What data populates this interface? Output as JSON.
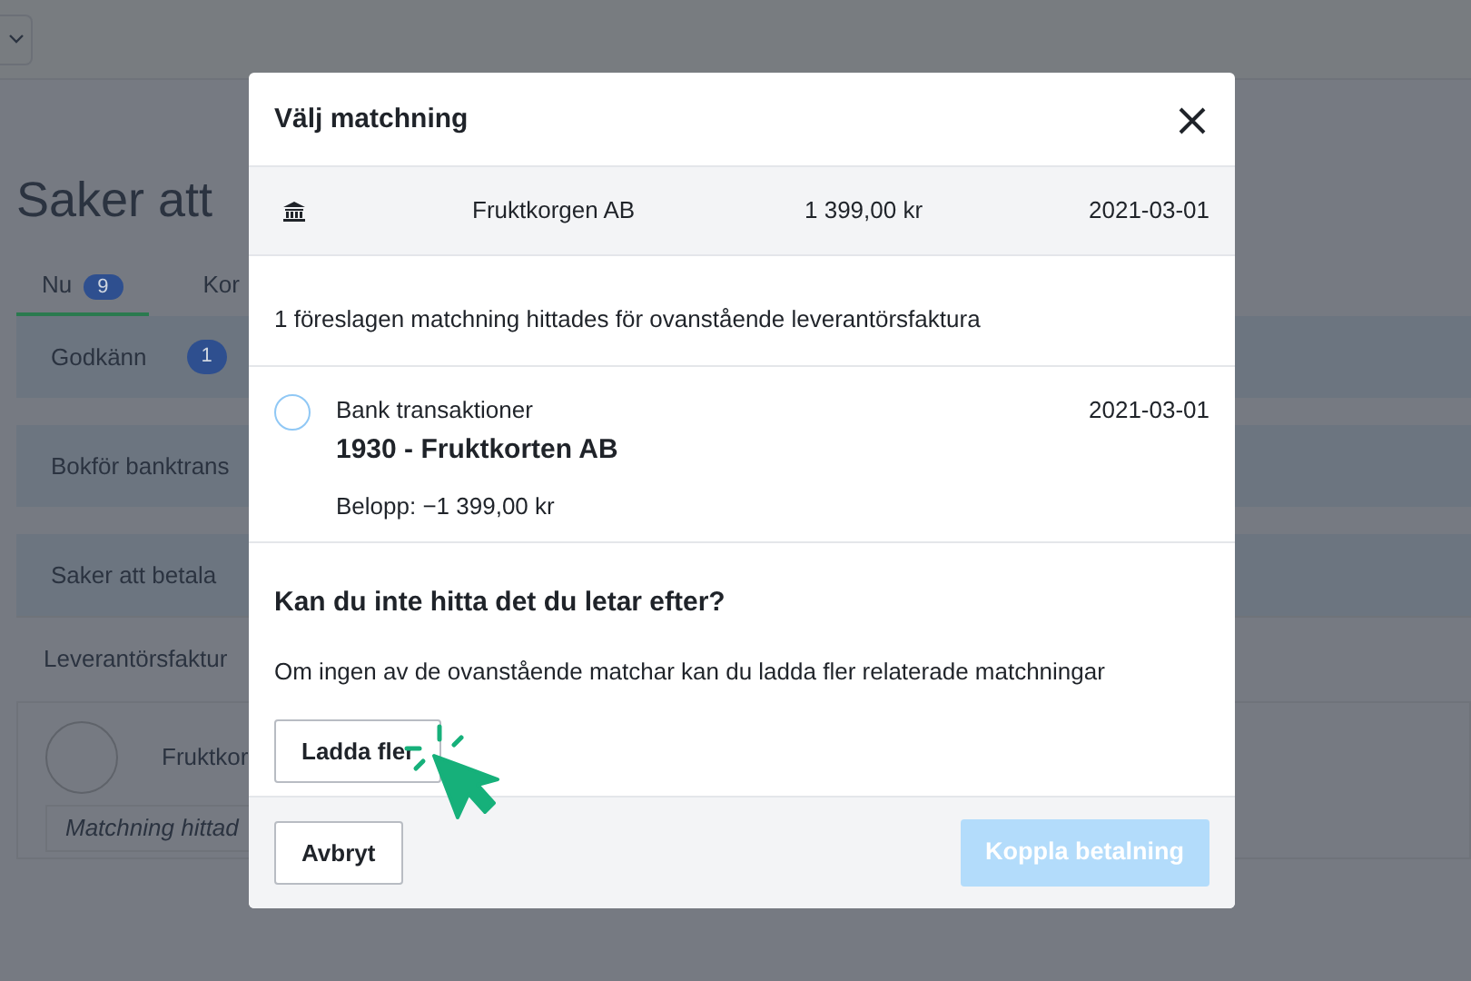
{
  "page": {
    "title": "Saker att",
    "tabs": [
      {
        "label": "Nu",
        "badge": "9",
        "selected": true
      },
      {
        "label": "Kor",
        "selected": false
      }
    ],
    "sections": [
      {
        "kind": "panel",
        "label": "Godkänn",
        "badge": "1"
      },
      {
        "kind": "panel",
        "label": "Bokför banktrans"
      },
      {
        "kind": "panel",
        "label": "Saker att betala"
      },
      {
        "kind": "subheader",
        "label": "Leverantörsfaktur"
      },
      {
        "kind": "invoice",
        "label": "Fruktkor",
        "note": "Matchning hittad"
      }
    ]
  },
  "dialog": {
    "title": "Välj matchning",
    "invoice": {
      "name": "Fruktkorgen AB",
      "amount": "1 399,00 kr",
      "date": "2021-03-01"
    },
    "summary": "1 föreslagen matchning hittades för ovanstående leverantörsfaktura",
    "matches": [
      {
        "source": "Bank transaktioner",
        "title": "1930 - Fruktkorten AB",
        "amount": "Belopp: −1 399,00 kr",
        "date": "2021-03-01",
        "selected": false
      }
    ],
    "help_title": "Kan du inte hitta det du letar efter?",
    "help_text": "Om ingen av de ovanstående matchar kan du ladda fler relaterade matchningar",
    "load_more": "Ladda fler",
    "cancel": "Avbryt",
    "confirm": {
      "label": "Koppla betalning",
      "disabled": true
    }
  }
}
